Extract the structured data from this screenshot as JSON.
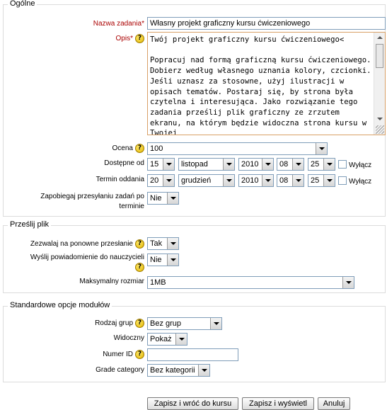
{
  "sections": {
    "general": "Ogólne",
    "upload": "Prześlij plik",
    "modules": "Standardowe opcje modułów"
  },
  "general": {
    "task_name_label": "Nazwa zadania",
    "task_name_value": "Własny projekt graficzny kursu ćwiczeniowego",
    "desc_label": "Opis",
    "desc_text": "Twój projekt graficzny kursu ćwiczeniowego<\n\nPopracuj nad formą graficzną kursu ćwiczeniowego. Dobierz według własnego uznania kolory, czcionki. Jeśli uznasz za stosowne, użyj ilustracji w opisach tematów. Postaraj się, by strona była czytelna i interesująca. Jako rozwiązanie tego zadania prześlij plik graficzny ze zrzutem ekranu, na którym będzie widoczna strona kursu w Twojej",
    "grade_label": "Ocena",
    "grade_value": "100",
    "available_label": "Dostępne od",
    "available": {
      "day": "15",
      "month": "listopad",
      "year": "2010",
      "hour": "08",
      "minute": "25"
    },
    "due_label": "Termin oddania",
    "due": {
      "day": "20",
      "month": "grudzień",
      "year": "2010",
      "hour": "08",
      "minute": "25"
    },
    "disable_label": "Wyłącz",
    "prevent_late_label_1": "Zapobiegaj przesyłaniu zadań po",
    "prevent_late_label_2": "terminie",
    "prevent_late_value": "Nie"
  },
  "upload": {
    "resubmit_label": "Zezwalaj na ponowne przesłanie",
    "resubmit_value": "Tak",
    "notify_label": "Wyślij powiadomienie do nauczycieli",
    "notify_value": "Nie",
    "max_size_label": "Maksymalny rozmiar",
    "max_size_value": "1MB"
  },
  "modules": {
    "group_mode_label": "Rodzaj grup",
    "group_mode_value": "Bez grup",
    "visible_label": "Widoczny",
    "visible_value": "Pokaż",
    "id_label": "Numer ID",
    "id_value": "",
    "grade_cat_label": "Grade category",
    "grade_cat_value": "Bez kategorii"
  },
  "buttons": {
    "save_return": "Zapisz i wróć do kursu",
    "save_display": "Zapisz i wyświetl",
    "cancel": "Anuluj"
  },
  "icons": {
    "help": "?",
    "required_star": "*"
  }
}
